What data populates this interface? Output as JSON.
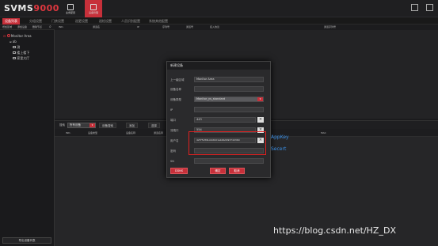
{
  "app": {
    "logo_main": "SVMS",
    "logo_sub": "9000"
  },
  "topbar": {
    "buttons": [
      {
        "label": "业务配置",
        "icon": "config-icon"
      },
      {
        "label": "设备管理",
        "icon": "device-icon"
      }
    ]
  },
  "nav": {
    "tabs": [
      "设备列表",
      "分组设置",
      "门禁设置",
      "巡更设置",
      "巡检设置",
      "人员识别配置",
      "系统其他配置"
    ]
  },
  "subbar": {
    "items": [
      "增加区域",
      "添加设备",
      "删除节点"
    ]
  },
  "table1": {
    "headers": [
      "IND.",
      "通道名",
      "IP",
      "序列号",
      "通道号",
      "接入协议",
      "通道序列号"
    ]
  },
  "tree": {
    "root": "Monitor Area",
    "children": [
      "ab",
      "测",
      "楼上楼下",
      "家里大厅"
    ]
  },
  "lower": {
    "search_label": "搜索",
    "select_value": "所有设备",
    "buttons": [
      "设备搜索",
      "添加",
      "选择"
    ],
    "headers": [
      "IND.",
      "设备类型",
      "设备名称",
      "通道名称",
      "MAC"
    ]
  },
  "left_button": "导出设备列表",
  "dialog": {
    "title": "新建设备",
    "fields": [
      {
        "label": "上一级区域",
        "value": "Monitor Area"
      },
      {
        "label": "设备名称",
        "value": ""
      },
      {
        "label": "设备类型",
        "value": "Monitor_ys_standard"
      },
      {
        "label": "IP",
        "value": ""
      },
      {
        "label": "端口",
        "value": "443"
      },
      {
        "label": "流端口",
        "value": "554"
      },
      {
        "label": "用户名",
        "value": "42f752fdb-b0db01ab0bd09374d360"
      },
      {
        "label": "密码",
        "value": ""
      },
      {
        "label": "SN",
        "value": ""
      }
    ],
    "buttons": {
      "left": "DDNS",
      "ok": "确定",
      "cancel": "取消"
    }
  },
  "annotations": {
    "appkey": "AppKey",
    "secret": "Secert"
  },
  "watermark": "https://blog.csdn.net/HZ_DX",
  "colors": {
    "accent": "#c7303a",
    "annotation": "#3a8fe6"
  }
}
